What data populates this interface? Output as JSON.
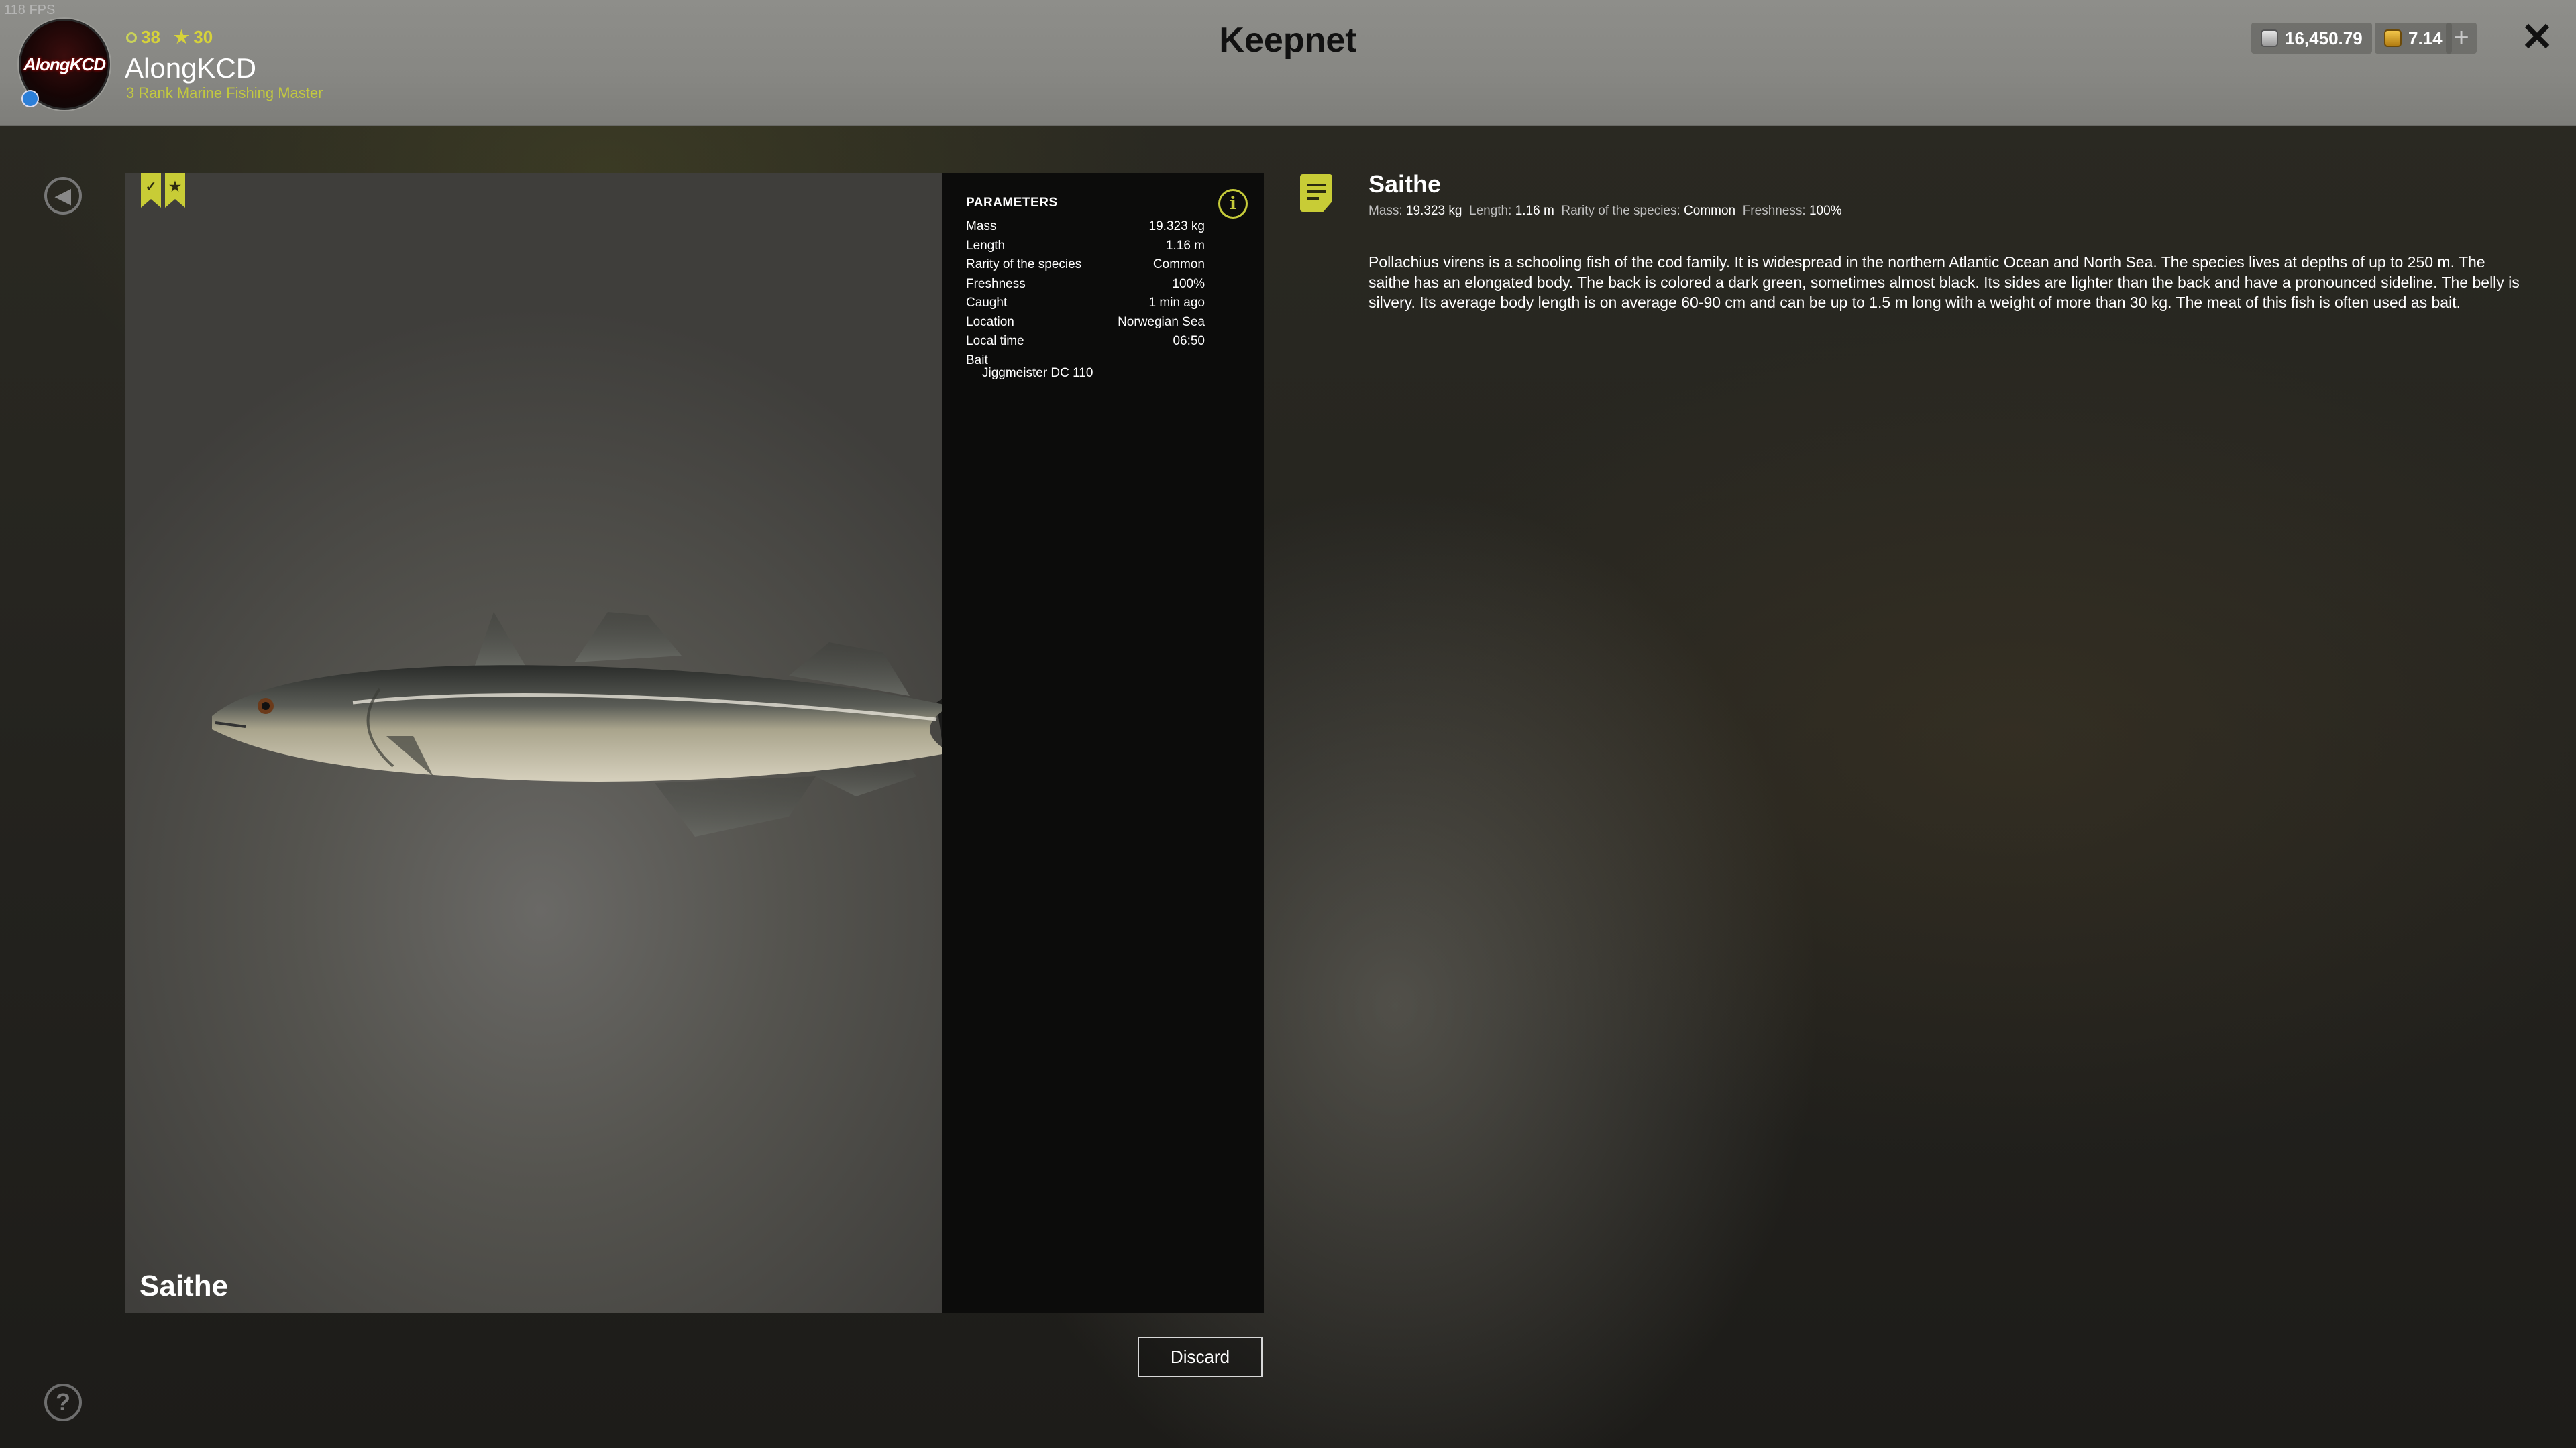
{
  "fps": "118 FPS",
  "header": {
    "title": "Keepnet",
    "avatar_text": "AlongKCD",
    "level": "38",
    "stars": "30",
    "username": "AlongKCD",
    "rank": "3 Rank Marine Fishing Master",
    "silver": "16,450.79",
    "gold": "7.14",
    "plus": "+",
    "close": "✕"
  },
  "fish": {
    "name": "Saithe"
  },
  "params": {
    "title": "PARAMETERS",
    "rows": [
      {
        "label": "Mass",
        "value": "19.323 kg"
      },
      {
        "label": "Length",
        "value": "1.16 m"
      },
      {
        "label": "Rarity of the species",
        "value": "Common"
      },
      {
        "label": "Freshness",
        "value": "100%"
      },
      {
        "label": "Caught",
        "value": "1 min ago"
      },
      {
        "label": "Location",
        "value": "Norwegian Sea"
      },
      {
        "label": "Local time",
        "value": "06:50"
      }
    ],
    "bait_label": "Bait",
    "bait_value": "Jiggmeister DC 110"
  },
  "discard_label": "Discard",
  "description": {
    "title": "Saithe",
    "mass_label": "Mass:",
    "mass_value": "19.323 kg",
    "length_label": "Length:",
    "length_value": "1.16 m",
    "rarity_label": "Rarity of the species:",
    "rarity_value": "Common",
    "freshness_label": "Freshness:",
    "freshness_value": "100%",
    "text": "Pollachius virens is a schooling fish of the cod family. It is widespread in the northern Atlantic Ocean and North Sea. The species lives at depths of up to 250 m. The saithe has an elongated body. The back is colored a dark green, sometimes almost black. Its sides are lighter than the back and have a pronounced sideline. The belly is silvery. Its average body length is on average 60-90 cm and can be up to 1.5 m long with a weight of more than 30 kg. The meat of this fish is often used as bait."
  },
  "help": "?",
  "colors": {
    "accent": "#c8cc36",
    "header_bg": "#8a8a86",
    "params_bg": "#0c0c0b"
  }
}
